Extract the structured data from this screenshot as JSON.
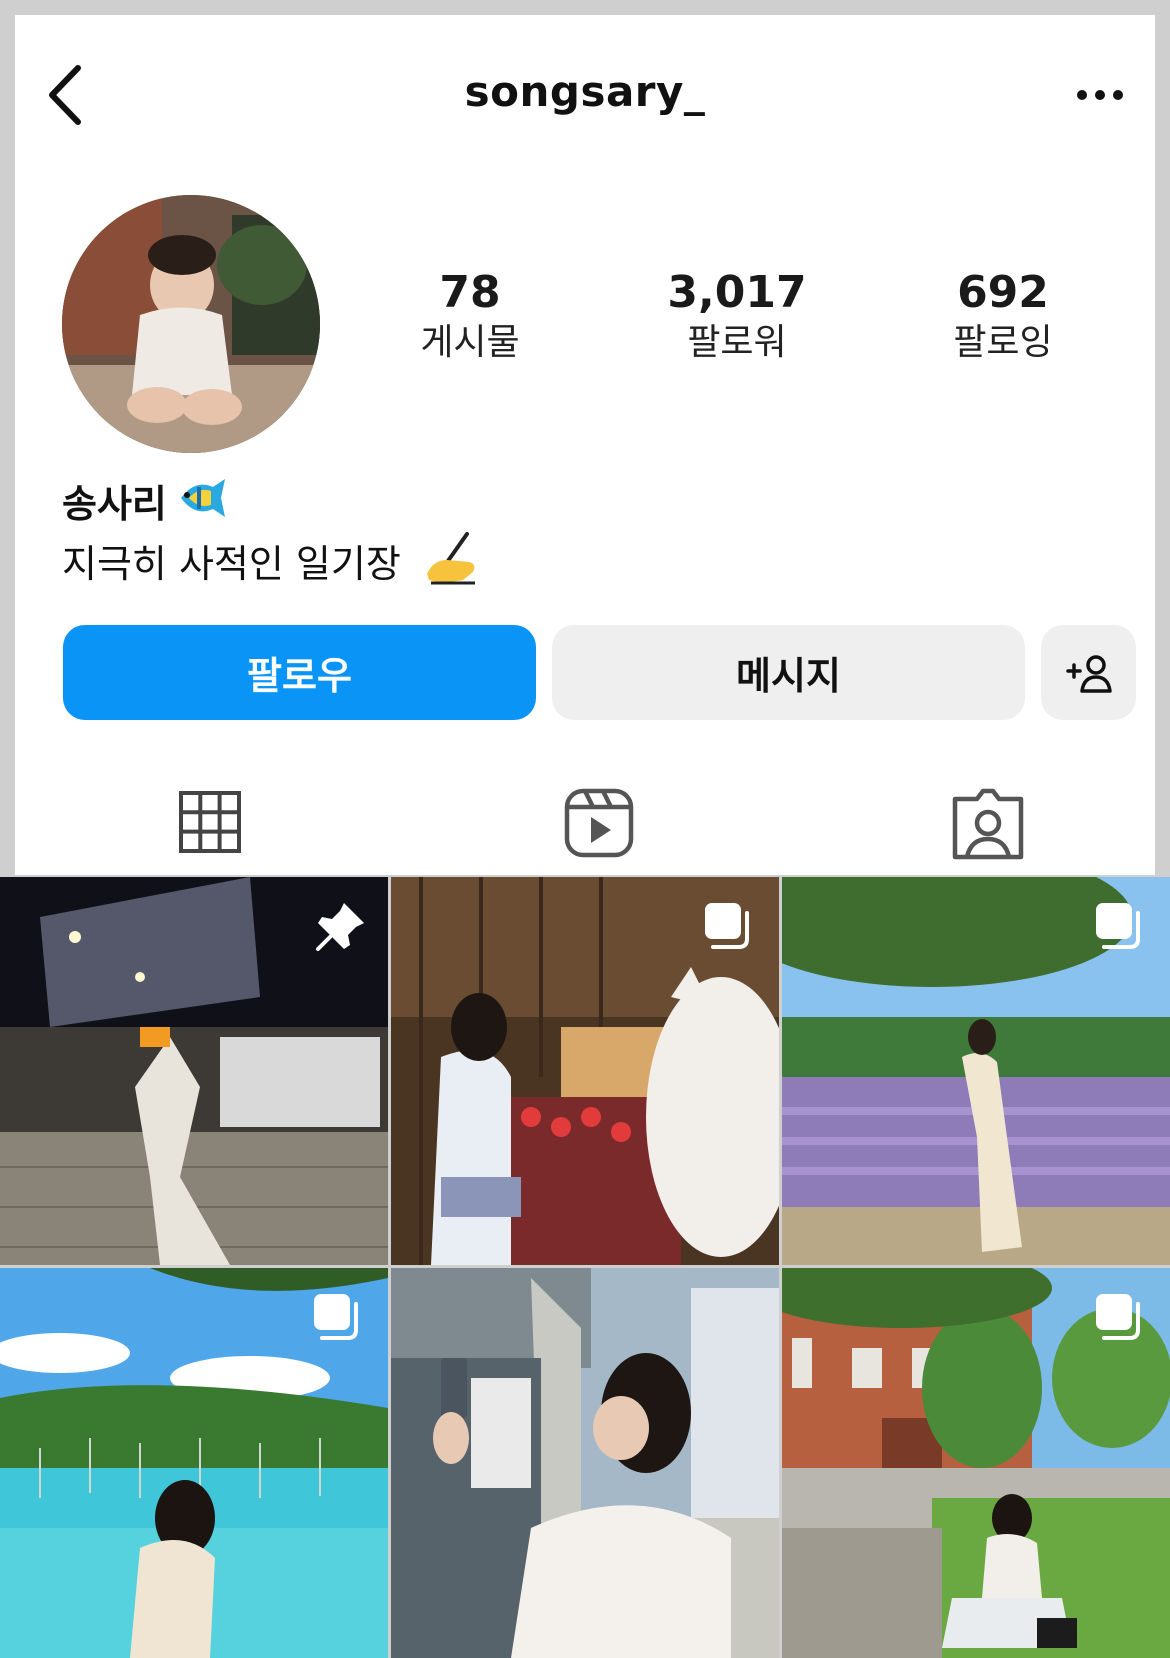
{
  "header": {
    "username": "songsary_",
    "back_icon": "chevron-left-icon",
    "more_icon": "more-horizontal-icon"
  },
  "profile": {
    "display_name": "송사리",
    "name_emoji": "tropical-fish-icon",
    "bio": "지극히 사적인 일기장",
    "bio_emoji": "writing-hand-icon",
    "stats": [
      {
        "value": "78",
        "label": "게시물"
      },
      {
        "value": "3,017",
        "label": "팔로워"
      },
      {
        "value": "692",
        "label": "팔로잉"
      }
    ]
  },
  "actions": {
    "follow_label": "팔로우",
    "message_label": "메시지",
    "add_icon": "add-person-icon"
  },
  "tabs": [
    {
      "icon": "grid-icon",
      "selected": true
    },
    {
      "icon": "reels-icon",
      "selected": false
    },
    {
      "icon": "tagged-icon",
      "selected": false
    }
  ],
  "colors": {
    "follow_blue": "#0a95f6",
    "secondary_button": "#efefef",
    "text": "#111111"
  },
  "posts": [
    {
      "badge": "pin-icon",
      "scene": "night stadium"
    },
    {
      "badge": "multi-photo-icon",
      "scene": "souvenir shop"
    },
    {
      "badge": "multi-photo-icon",
      "scene": "lavender field"
    },
    {
      "badge": "multi-photo-icon",
      "scene": "blue pond"
    },
    {
      "badge": "multi-photo-icon",
      "scene": "city selfie"
    },
    {
      "badge": "multi-photo-icon",
      "scene": "brick building park"
    }
  ]
}
